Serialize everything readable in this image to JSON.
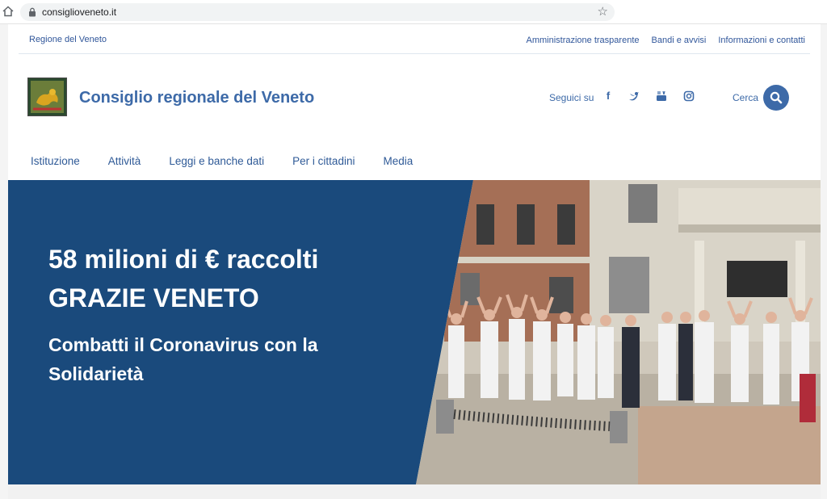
{
  "browser": {
    "url": "consiglioveneto.it"
  },
  "utility": {
    "region_link": "Regione del Veneto",
    "links": [
      "Amministrazione trasparente",
      "Bandi e avvisi",
      "Informazioni e contatti"
    ]
  },
  "header": {
    "title": "Consiglio regionale del Veneto",
    "follow_label": "Seguici su",
    "social_icons": [
      "facebook-icon",
      "twitter-icon",
      "youtube-icon",
      "instagram-icon"
    ],
    "search_label": "Cerca"
  },
  "nav": {
    "items": [
      "Istituzione",
      "Attività",
      "Leggi e banche dati",
      "Per i cittadini",
      "Media"
    ]
  },
  "hero": {
    "line1": "58 milioni di € raccolti",
    "line2": "GRAZIE VENETO",
    "subtitle": "Combatti il Coronavirus con la Solidarietà"
  },
  "colors": {
    "brand_blue": "#3d6aa8",
    "hero_blue": "#1a4a7c",
    "link_blue": "#30569a"
  }
}
